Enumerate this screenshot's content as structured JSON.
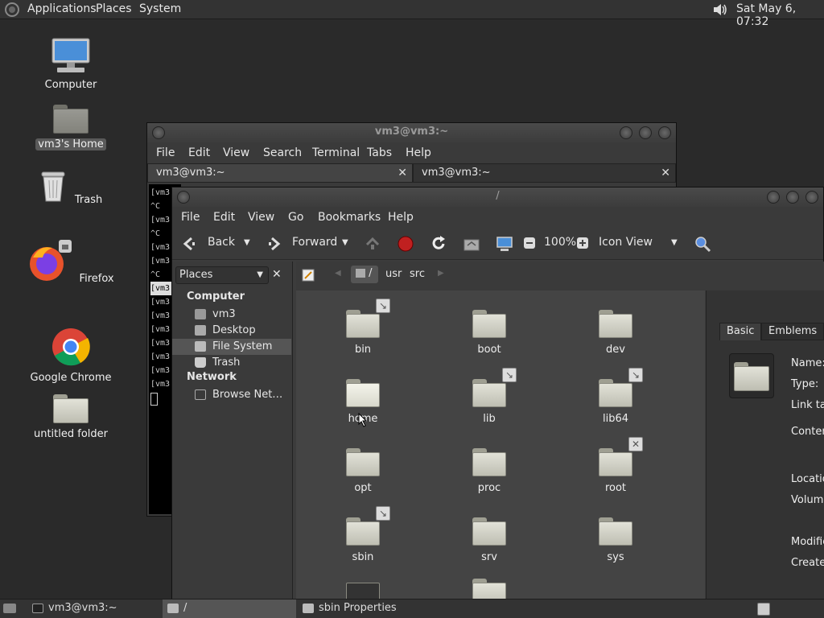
{
  "top_panel": {
    "menu": [
      "Applications",
      "Places",
      "System"
    ],
    "clock": "Sat May  6, 07:32"
  },
  "desktop": {
    "icons": [
      {
        "label": "Computer"
      },
      {
        "label": "vm3's Home"
      },
      {
        "label": "Trash"
      },
      {
        "label": "Firefox"
      },
      {
        "label": "Google Chrome"
      },
      {
        "label": "untitled folder"
      }
    ]
  },
  "terminal": {
    "title": "vm3@vm3:~",
    "menu": [
      "File",
      "Edit",
      "View",
      "Search",
      "Terminal",
      "Tabs",
      "Help"
    ],
    "tabs": [
      "vm3@vm3:~",
      "vm3@vm3:~"
    ],
    "lines": [
      "[vm3",
      "^C",
      "[vm3",
      "^C",
      "[vm3",
      "[vm3",
      "^C",
      "[vm3",
      "[vm3",
      "[vm3",
      "[vm3",
      "[vm3",
      "[vm3",
      "[vm3",
      "[vm3"
    ]
  },
  "file_manager": {
    "title": "/",
    "menu": [
      "File",
      "Edit",
      "View",
      "Go",
      "Bookmarks",
      "Help"
    ],
    "toolbar": {
      "back": "Back",
      "forward": "Forward",
      "zoom": "100%",
      "view_mode": "Icon View"
    },
    "location": {
      "path": [
        "/",
        "usr",
        "src"
      ]
    },
    "sidebar": {
      "combo": "Places",
      "sections": [
        {
          "heading": "Computer",
          "items": [
            "vm3",
            "Desktop",
            "File System",
            "Trash"
          ]
        },
        {
          "heading": "Network",
          "items": [
            "Browse Net…"
          ]
        }
      ]
    },
    "files": [
      "bin",
      "boot",
      "dev",
      "home",
      "lib",
      "lib64",
      "opt",
      "proc",
      "root",
      "sbin",
      "srv",
      "sys"
    ],
    "properties": {
      "tabs": [
        "Basic",
        "Emblems"
      ],
      "labels": [
        "Name:",
        "Type:",
        "Link tar",
        "Conten",
        "Locatio",
        "Volume",
        "Modifie",
        "Created"
      ]
    }
  },
  "taskbar": {
    "tasks": [
      "vm3@vm3:~",
      "/",
      "sbin Properties"
    ]
  }
}
